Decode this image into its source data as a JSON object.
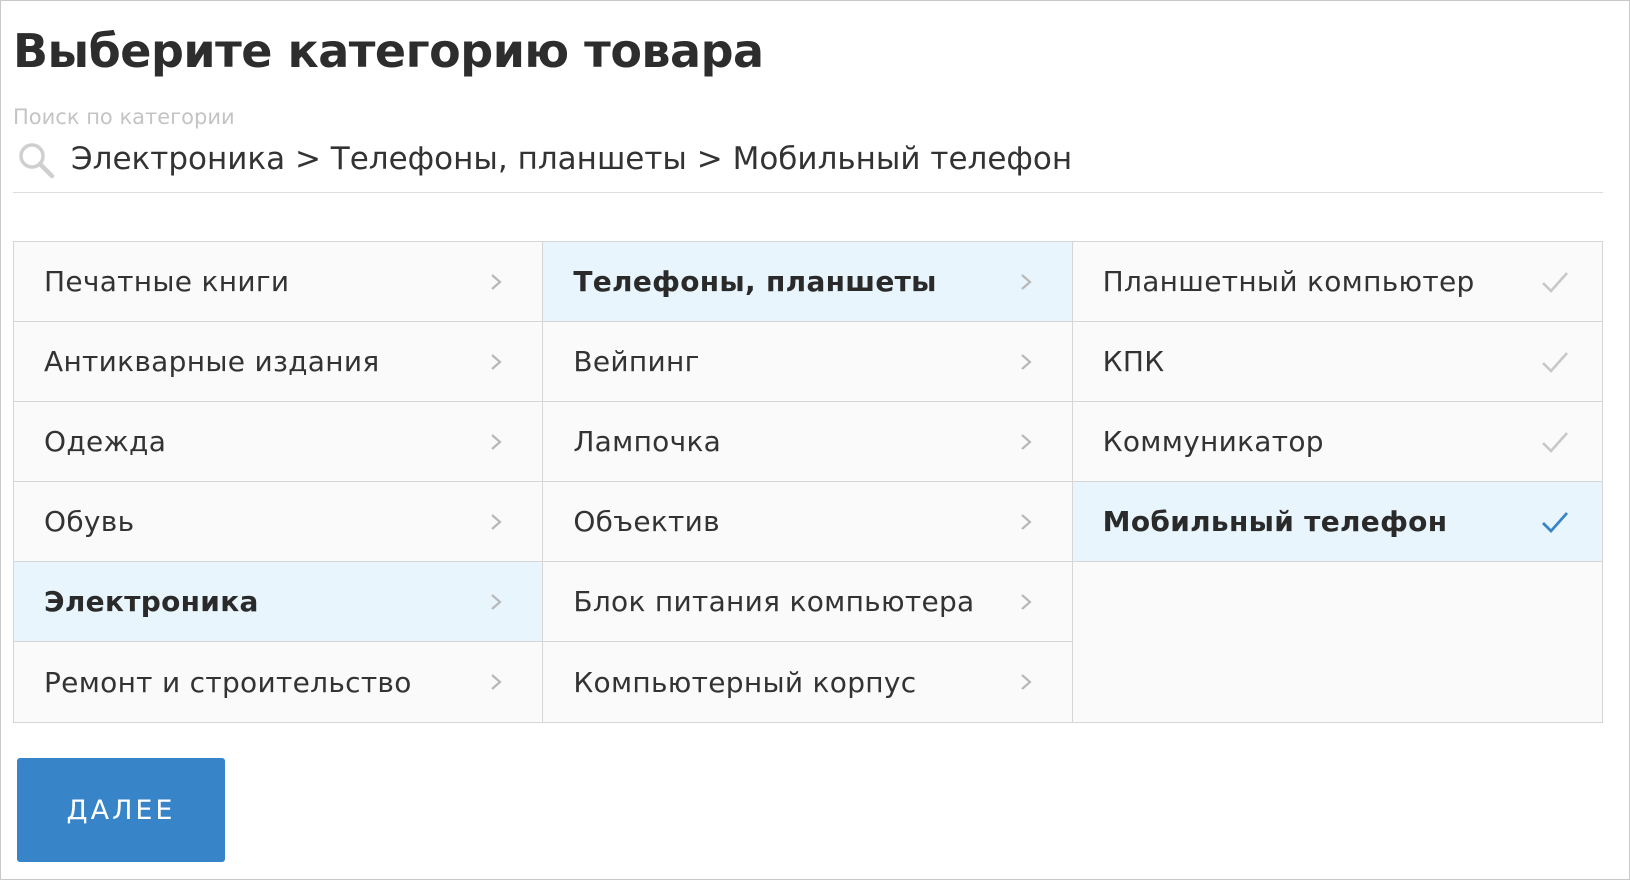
{
  "page": {
    "title": "Выберите категорию товара"
  },
  "search": {
    "label": "Поиск по категории",
    "value": "Электроника > Телефоны, планшеты > Мобильный телефон",
    "icon": "search-icon"
  },
  "columns": [
    {
      "items": [
        {
          "label": "Печатные книги",
          "selected": false
        },
        {
          "label": "Антикварные издания",
          "selected": false
        },
        {
          "label": "Одежда",
          "selected": false
        },
        {
          "label": "Обувь",
          "selected": false
        },
        {
          "label": "Электроника",
          "selected": true
        },
        {
          "label": "Ремонт и строительство",
          "selected": false
        }
      ]
    },
    {
      "items": [
        {
          "label": "Телефоны, планшеты",
          "selected": true
        },
        {
          "label": "Вейпинг",
          "selected": false
        },
        {
          "label": "Лампочка",
          "selected": false
        },
        {
          "label": "Объектив",
          "selected": false
        },
        {
          "label": "Блок питания компьютера",
          "selected": false
        },
        {
          "label": "Компьютерный корпус",
          "selected": false
        }
      ]
    },
    {
      "items": [
        {
          "label": "Планшетный компьютер",
          "selected": false
        },
        {
          "label": "КПК",
          "selected": false
        },
        {
          "label": "Коммуникатор",
          "selected": false
        },
        {
          "label": "Мобильный телефон",
          "selected": true
        }
      ]
    }
  ],
  "actions": {
    "next_label": "ДАЛЕЕ"
  },
  "colors": {
    "accent": "#3784c8",
    "selected_bg": "#e8f5fc",
    "check_inactive": "#c8c8c8",
    "check_active": "#3784c8",
    "chevron": "#b8b8b8"
  }
}
